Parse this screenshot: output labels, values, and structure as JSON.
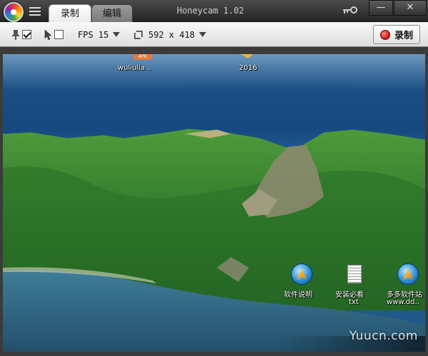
{
  "titlebar": {
    "title": "Honeycam 1.02",
    "tabs": [
      {
        "label": "录制",
        "active": true
      },
      {
        "label": "编辑",
        "active": false
      }
    ],
    "minimize_glyph": "—",
    "close_glyph": "✕"
  },
  "toolbar": {
    "always_on_top_checked": true,
    "show_cursor_checked": false,
    "fps_text": "FPS 15",
    "size_text": "592 x 418",
    "record_label": "录制"
  },
  "desktop": {
    "top_icons": [
      {
        "label": "wuliulia ..",
        "icon": "apk-icon",
        "badge": "APK"
      },
      {
        "label": "2016",
        "icon": "folder-icon"
      }
    ],
    "bottom_icons": [
      {
        "label": "软件说明",
        "icon": "shortcut-globe-icon"
      },
      {
        "label": "安装必看",
        "sublabel": "txt",
        "icon": "text-file-icon"
      },
      {
        "label": "多多软件站",
        "sublabel": "www.dd..",
        "icon": "shortcut-globe-icon"
      }
    ],
    "watermark": "Yuucn.com"
  },
  "colors": {
    "titlebar": "#333333",
    "toolbar": "#e8e8e8",
    "record_red": "#e53935",
    "sea": "#1c4f84"
  }
}
